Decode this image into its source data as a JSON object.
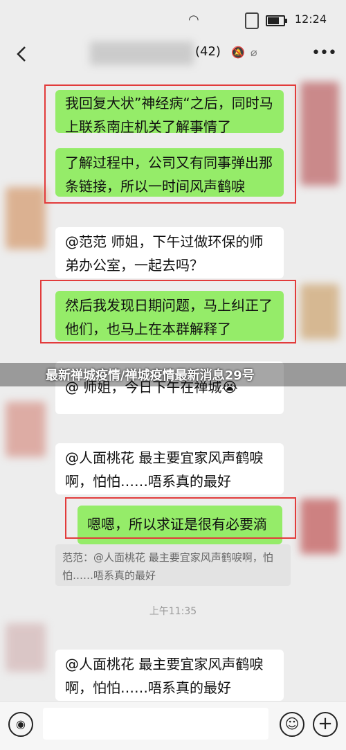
{
  "status_bar": {
    "time": "12:24",
    "battery_level": 0.8
  },
  "header": {
    "member_count": "(42)",
    "back_icon": "chevron-left-icon",
    "mute_icon": "bell-off-icon",
    "more_icon": "more-dots-icon"
  },
  "messages": [
    {
      "type": "sent",
      "text": "我回复大状”神经病“之后，同时马上联系南庄机关了解事情了",
      "marked": true
    },
    {
      "type": "sent",
      "text": "了解过程中，公司又有同事弹出那条链接，所以一时间风声鹤唳",
      "marked": true
    },
    {
      "type": "received",
      "text": "@范范  师姐，下午过做环保的师弟办公室，一起去吗？"
    },
    {
      "type": "sent",
      "text": "然后我发现日期问题，马上纠正了他们，也马上在本群解释了",
      "marked": true
    },
    {
      "type": "received",
      "text": "@          师姐，今日下午在禅城😭"
    },
    {
      "type": "received",
      "text": "@人面桃花  最主要宜家风声鹤唳啊，怕怕……唔系真的最好"
    },
    {
      "type": "sent",
      "text": "嗯嗯，所以求证是很有必要滴",
      "marked": true
    }
  ],
  "quote": {
    "text": "范范：@人面桃花 最主要宜家风声鹤唳啊，怕怕……唔系真的最好"
  },
  "timestamp": "上午11:35",
  "last_message": {
    "type": "received",
    "text": "@人面桃花  最主要宜家风声鹤唳啊，怕怕……唔系真的最好"
  },
  "banner": {
    "text": "最新禅城疫情/禅城疫情最新消息29号"
  },
  "input_bar": {
    "voice_icon": "voice-icon",
    "emoji_icon": "emoji-icon",
    "plus_icon": "plus-icon"
  }
}
